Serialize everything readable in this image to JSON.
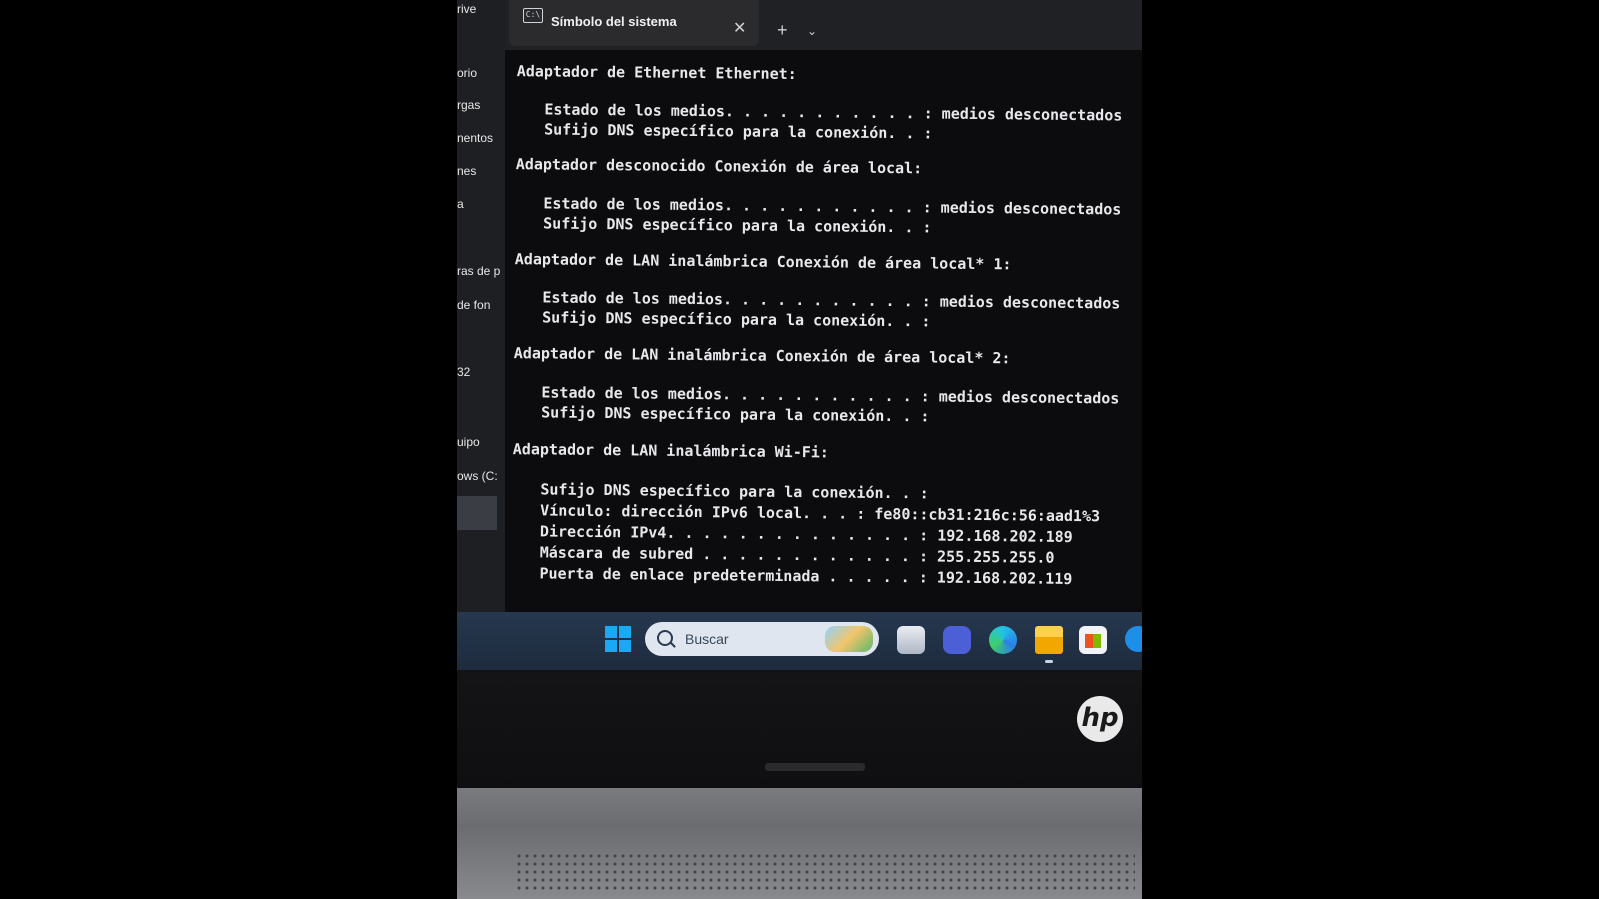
{
  "explorer": {
    "items": [
      "rive",
      "orio",
      "rgas",
      "nentos",
      "nes",
      "a",
      "ras de p",
      "de fon",
      "32",
      "uipo",
      "ows (C:"
    ]
  },
  "terminal": {
    "tab_title": "Símbolo del sistema",
    "tab_close_icon": "close-icon",
    "new_tab_label": "+",
    "dropdown_label": "⌄",
    "tab_icon_label": "C:\\"
  },
  "console": {
    "lines": [
      "Adaptador de Ethernet Ethernet:",
      "Estado de los medios. . . . . . . . . . . : medios desconectados",
      "Sufijo DNS específico para la conexión. . :",
      "Adaptador desconocido Conexión de área local:",
      "Estado de los medios. . . . . . . . . . . : medios desconectados",
      "Sufijo DNS específico para la conexión. . :",
      "Adaptador de LAN inalámbrica Conexión de área local* 1:",
      "Estado de los medios. . . . . . . . . . . : medios desconectados",
      "Sufijo DNS específico para la conexión. . :",
      "Adaptador de LAN inalámbrica Conexión de área local* 2:",
      "Estado de los medios. . . . . . . . . . . : medios desconectados",
      "Sufijo DNS específico para la conexión. . :",
      "Adaptador de LAN inalámbrica Wi-Fi:",
      "Sufijo DNS específico para la conexión. . :",
      "Vínculo: dirección IPv6 local. . . : fe80::cb31:216c:56:aad1%3",
      "Dirección IPv4. . . . . . . . . . . . . . : 192.168.202.189",
      "Máscara de subred . . . . . . . . . . . . : 255.255.255.0",
      "Puerta de enlace predeterminada . . . . . : 192.168.202.119"
    ]
  },
  "taskbar": {
    "search_placeholder": "Buscar",
    "icons": [
      "windows-start-icon",
      "search-icon",
      "task-view-icon",
      "chat-icon",
      "edge-icon",
      "file-explorer-icon",
      "store-icon",
      "help-icon"
    ]
  },
  "laptop": {
    "logo": "hp"
  },
  "colors": {
    "console_bg": "#0c0c0e",
    "console_text": "#e8e8ec",
    "taskbar": "#26384f",
    "start_blue": "#1aa9f5"
  }
}
